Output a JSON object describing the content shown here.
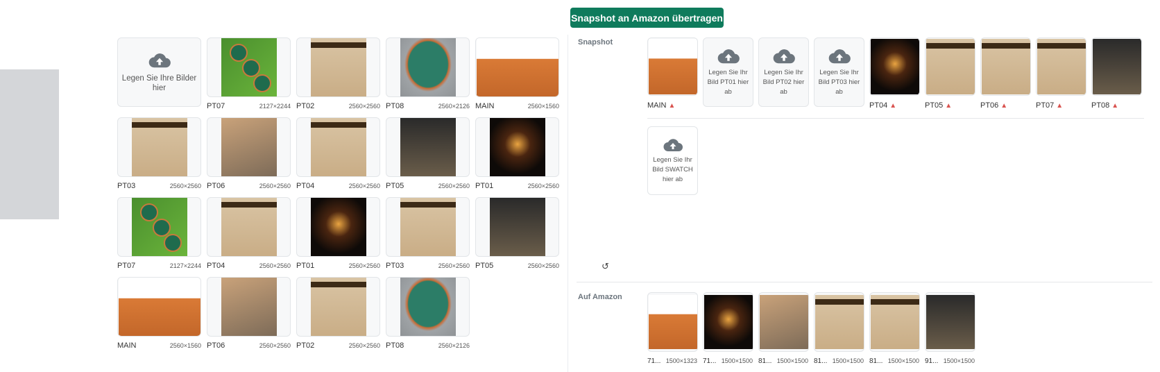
{
  "top_button": "Snapshot an Amazon übertragen",
  "left_grid": {
    "upload_label": "Legen Sie Ihre Bilder hier",
    "rows": [
      [
        {
          "type": "upload"
        },
        {
          "name": "PT07",
          "dim": "2127×2244",
          "img": "grass"
        },
        {
          "name": "PT02",
          "dim": "2560×2560",
          "img": "beige"
        },
        {
          "name": "PT08",
          "dim": "2560×2126",
          "img": "bowl"
        },
        {
          "name": "MAIN",
          "dim": "2560×1560",
          "img": "terr"
        }
      ],
      [
        {
          "name": "PT03",
          "dim": "2560×2560",
          "img": "beige"
        },
        {
          "name": "PT06",
          "dim": "2560×2560",
          "img": "people"
        },
        {
          "name": "PT04",
          "dim": "2560×2560",
          "img": "beige"
        },
        {
          "name": "PT05",
          "dim": "2560×2560",
          "img": "night"
        },
        {
          "name": "PT01",
          "dim": "2560×2560",
          "img": "dark"
        }
      ],
      [
        {
          "name": "PT07",
          "dim": "2127×2244",
          "img": "grass"
        },
        {
          "name": "PT04",
          "dim": "2560×2560",
          "img": "beige"
        },
        {
          "name": "PT01",
          "dim": "2560×2560",
          "img": "dark"
        },
        {
          "name": "PT03",
          "dim": "2560×2560",
          "img": "beige"
        },
        {
          "name": "PT05",
          "dim": "2560×2560",
          "img": "night"
        }
      ],
      [
        {
          "name": "MAIN",
          "dim": "2560×1560",
          "img": "terr"
        },
        {
          "name": "PT06",
          "dim": "2560×2560",
          "img": "people"
        },
        {
          "name": "PT02",
          "dim": "2560×2560",
          "img": "beige"
        },
        {
          "name": "PT08",
          "dim": "2560×2126",
          "img": "bowl"
        }
      ]
    ]
  },
  "snapshot": {
    "label": "Snapshot",
    "items": [
      {
        "name": "MAIN",
        "img": "terr",
        "warn": true
      },
      {
        "upload": "Legen Sie Ihr Bild PT01 hier ab"
      },
      {
        "upload": "Legen Sie Ihr Bild PT02 hier ab"
      },
      {
        "upload": "Legen Sie Ihr Bild PT03 hier ab"
      },
      {
        "name": "PT04",
        "img": "dark",
        "warn": true
      },
      {
        "name": "PT05",
        "img": "beige",
        "warn": true
      },
      {
        "name": "PT06",
        "img": "beige",
        "warn": true
      },
      {
        "name": "PT07",
        "img": "beige",
        "warn": true
      },
      {
        "name": "PT08",
        "img": "night",
        "warn": true
      }
    ],
    "swatch_upload": "Legen Sie Ihr Bild SWATCH hier ab",
    "reset_icon": "↺"
  },
  "amazon": {
    "label": "Auf Amazon",
    "items": [
      {
        "name": "71...",
        "dim": "1500×1323",
        "img": "terr"
      },
      {
        "name": "71...",
        "dim": "1500×1500",
        "img": "dark"
      },
      {
        "name": "81...",
        "dim": "1500×1500",
        "img": "people"
      },
      {
        "name": "81...",
        "dim": "1500×1500",
        "img": "beige"
      },
      {
        "name": "81...",
        "dim": "1500×1500",
        "img": "beige"
      },
      {
        "name": "91...",
        "dim": "1500×1500",
        "img": "night"
      }
    ]
  },
  "colors": {
    "accent": "#0f7b5c",
    "warn": "#d9534f"
  }
}
